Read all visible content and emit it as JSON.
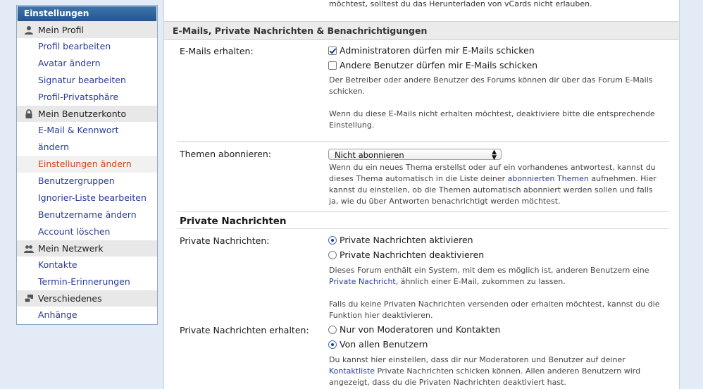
{
  "sidebar": {
    "header": "Einstellungen",
    "groups": [
      {
        "label": "Mein Profil",
        "icon": "user-icon"
      },
      {
        "label": "Mein Benutzerkonto",
        "icon": "lock-icon"
      },
      {
        "label": "Mein Netzwerk",
        "icon": "users-icon"
      },
      {
        "label": "Verschiedenes",
        "icon": "misc-icon"
      }
    ],
    "profil_items": [
      "Profil bearbeiten",
      "Avatar ändern",
      "Signatur bearbeiten",
      "Profil-Privatsphäre"
    ],
    "konto_items": [
      "E-Mail & Kennwort",
      "ändern",
      "Einstellungen ändern",
      "Benutzergruppen",
      "Ignorier-Liste bearbeiten",
      "Benutzername ändern",
      "Account löschen"
    ],
    "netzwerk_items": [
      "Kontakte",
      "Termin-Erinnerungen"
    ],
    "verschiedenes_items": [
      "Anhänge"
    ]
  },
  "main": {
    "intro_text": "möchtest, solltest du das Herunterladen von vCards nicht erlauben.",
    "section_title": "E-Mails, Private Nachrichten & Benachrichtigungen",
    "emails": {
      "label": "E-Mails erhalten:",
      "option_admin": "Administratoren dürfen mir E-Mails schicken",
      "option_users": "Andere Benutzer dürfen mir E-Mails schicken",
      "desc1_line1": "Der Betreiber oder andere Benutzer des Forums können dir über das Forum E-Mails",
      "desc1_line2": "schicken.",
      "desc2_line1": "Wenn du diese E-Mails nicht erhalten möchtest, deaktiviere bitte die entsprechende",
      "desc2_line2": "Einstellung."
    },
    "themen": {
      "label": "Themen abonnieren:",
      "selected": "Nicht abonnieren",
      "desc_line1": "Wenn du ein neues Thema erstellst oder auf ein vorhandenes antwortest, kannst du",
      "desc_line2_pre": "dieses Thema automatisch in die Liste deiner ",
      "desc_line2_link": "abonnierten Themen",
      "desc_line2_post": " aufnehmen. Hier",
      "desc_line3": "kannst du einstellen, ob die Themen automatisch abonniert werden sollen und falls",
      "desc_line4": "ja, wie du über Antworten benachrichtigt werden möchtest."
    },
    "pn": {
      "heading": "Private Nachrichten",
      "label": "Private Nachrichten:",
      "option_on": "Private Nachrichten aktivieren",
      "option_off": "Private Nachrichten deaktivieren",
      "desc1_line1": "Dieses Forum enthält ein System, mit dem es möglich ist, anderen Benutzern eine",
      "desc1_link": "Private Nachricht",
      "desc1_line2_post": ", ähnlich einer E-Mail, zukommen zu lassen.",
      "desc2_line1": "Falls du keine Privaten Nachrichten versenden oder erhalten möchtest, kannst du die",
      "desc2_line2": "Funktion hier deaktivieren."
    },
    "pn_receive": {
      "label": "Private Nachrichten erhalten:",
      "option_mods": "Nur von Moderatoren und Kontakten",
      "option_all": "Von allen Benutzern",
      "desc_line1": "Du kannst hier einstellen, dass dir nur Moderatoren und Benutzer auf deiner",
      "desc_link": "Kontaktliste",
      "desc_line2_post": " Private Nachrichten schicken können. Allen anderen Benutzern wird",
      "desc_line3": "angezeigt, dass du die Privaten Nachrichten deaktiviert hast."
    }
  }
}
